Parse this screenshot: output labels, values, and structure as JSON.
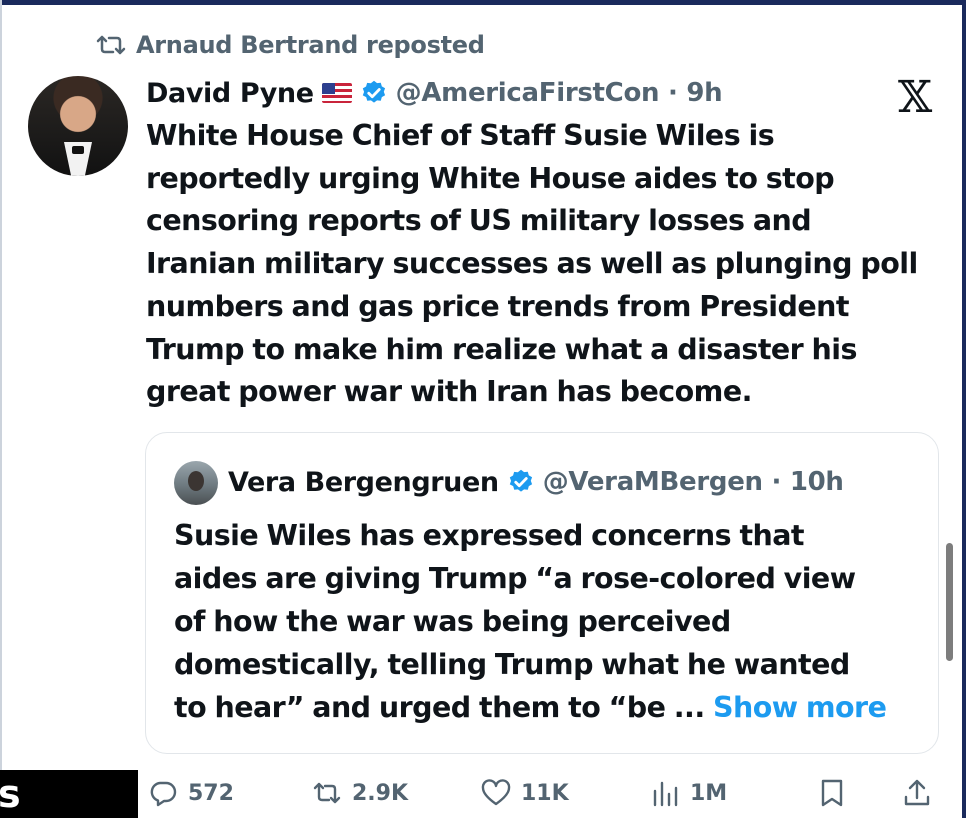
{
  "repost": {
    "text": "Arnaud Bertrand reposted",
    "icon": "repost-icon"
  },
  "tweet": {
    "author_name": "David Pyne",
    "flag": "us-flag-icon",
    "verified": "verified-badge-icon",
    "handle_time": "@AmericaFirstCon · 9h",
    "platform_logo": "𝕏",
    "body_lines": [
      "White House Chief of Staff Susie Wiles is",
      "reportedly urging White House aides to stop",
      "censoring reports of US military losses and",
      "Iranian military successes as well as plunging poll",
      "numbers and gas price trends from President",
      "Trump to make him realize what a disaster his",
      "great power war with Iran has become."
    ]
  },
  "quote": {
    "author_name": "Vera Bergengruen",
    "handle_time": "@VeraMBergen · 10h",
    "body_lines": [
      "Susie Wiles has expressed concerns that",
      "aides are giving Trump “a rose-colored view",
      "of how the war was being perceived",
      "domestically, telling Trump what he wanted"
    ],
    "last_line": "to hear” and urged them to “be ... ",
    "show_more": "Show more"
  },
  "actions": {
    "replies": "572",
    "reposts": "2.9K",
    "likes": "11K",
    "views": "1M"
  },
  "overlay_letter": "s",
  "colors": {
    "accent": "#1d9bf0",
    "muted": "#536471",
    "text": "#0f1419"
  }
}
